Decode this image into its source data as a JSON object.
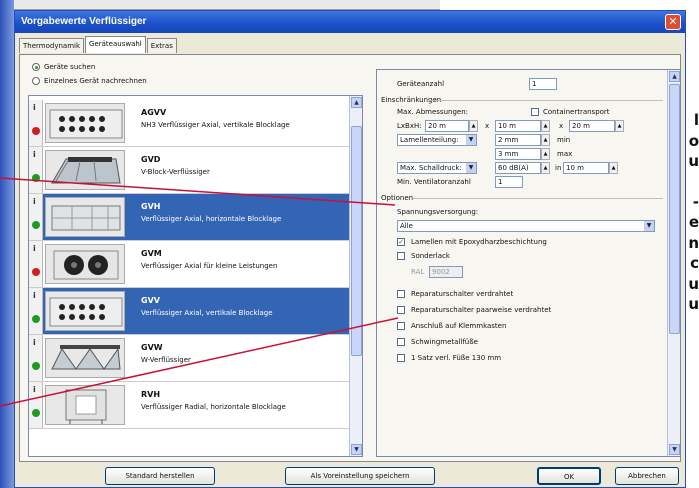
{
  "dialog": {
    "title": "Vorgabewerte Verflüssiger",
    "close_glyph": "✕"
  },
  "tabs": [
    {
      "label": "Thermodynamik",
      "active": false
    },
    {
      "label": "Geräteauswahl",
      "active": true
    },
    {
      "label": "Extras",
      "active": false
    }
  ],
  "search": {
    "option_search": "Geräte suchen",
    "option_recalc": "Einzelnes Gerät nachrechnen"
  },
  "devices": [
    {
      "name": "AGVV",
      "desc": "NH3 Verflüssiger Axial, vertikale Blocklage",
      "status": "red",
      "selected": false
    },
    {
      "name": "GVD",
      "desc": "V-Block-Verflüssiger",
      "status": "green",
      "selected": false
    },
    {
      "name": "GVH",
      "desc": "Verflüssiger Axial, horizontale Blocklage",
      "status": "green",
      "selected": true
    },
    {
      "name": "GVM",
      "desc": "Verflüssiger Axial für kleine Leistungen",
      "status": "red",
      "selected": false
    },
    {
      "name": "GVV",
      "desc": "Verflüssiger Axial, vertikale Blocklage",
      "status": "green",
      "selected": true
    },
    {
      "name": "GVW",
      "desc": "W-Verflüssiger",
      "status": "green",
      "selected": false
    },
    {
      "name": "RVH",
      "desc": "Verflüssiger Radial, horizontale Blocklage",
      "status": "green",
      "selected": false
    }
  ],
  "settings": {
    "device_count_label": "Geräteanzahl",
    "device_count_value": "1",
    "restrictions_head": "Einschränkungen",
    "max_dims_label": "Max. Abmessungen:",
    "container_label": "Containertransport",
    "lxbxh_label": "LxBxH:",
    "length_value": "20 m",
    "x1": "x",
    "width_value": "10 m",
    "x2": "x",
    "height_value": "20 m",
    "fin_label": "Lamellenteilung:",
    "fin_min_value": "2 mm",
    "fin_min_unit": "min",
    "fin_max_value": "3 mm",
    "fin_max_unit": "max",
    "sound_label": "Max. Schalldruck:",
    "sound_value": "60 dB(A)",
    "sound_in": "in",
    "sound_dist": "10 m",
    "min_fans_label": "Min. Ventilatoranzahl",
    "min_fans_value": "1",
    "options_head": "Optionen",
    "voltage_label": "Spannungsversorgung:",
    "voltage_value": "Alle",
    "opt_epoxy": "Lamellen mit Epoxydharzbeschichtung",
    "opt_special": "Sonderlack",
    "ral_label": "RAL",
    "ral_value": "9002",
    "opt_switch": "Reparaturschalter verdrahtet",
    "opt_switch_pair": "Reparaturschalter paarweise verdrahtet",
    "opt_terminal": "Anschluß auf Klemmkasten",
    "opt_vibration": "Schwingmetallfüße",
    "opt_set": "1 Satz verl. Füße 130 mm"
  },
  "buttons": {
    "standard": "Standard herstellen",
    "save_default": "Als Voreinstellung speichern",
    "ok": "OK",
    "cancel": "Abbrechen"
  },
  "side_letters": [
    "l",
    "o",
    "u",
    "-",
    "e",
    "n",
    "c",
    "u",
    "u"
  ],
  "colors": {
    "title_blue": "#1a4fc8",
    "selection_blue": "#3465b5",
    "status_red": "#cc2020",
    "status_green": "#209a20",
    "leader_red": "#c8103a"
  }
}
